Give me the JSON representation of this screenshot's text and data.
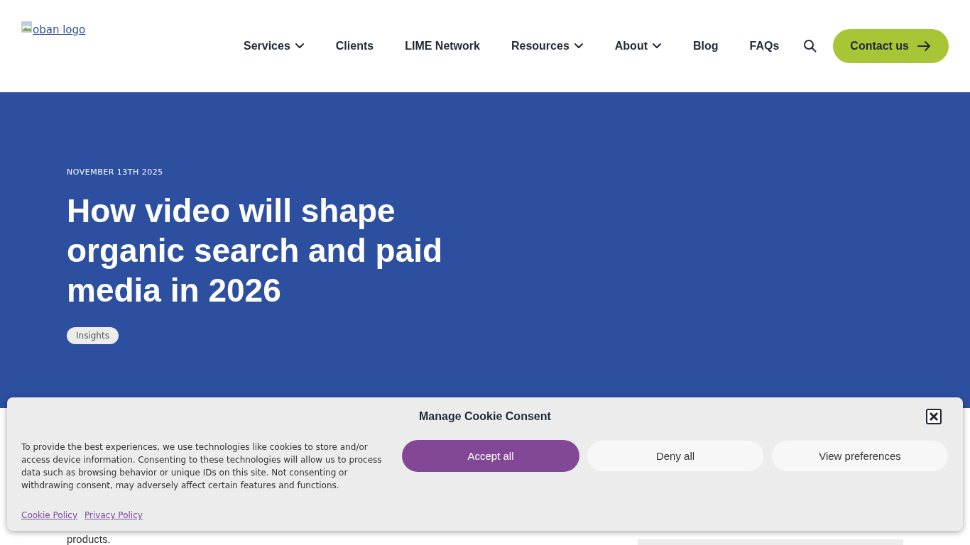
{
  "header": {
    "logo_alt": "oban logo",
    "nav": [
      {
        "label": "Services",
        "dropdown": true
      },
      {
        "label": "Clients",
        "dropdown": false
      },
      {
        "label": "LIME Network",
        "dropdown": false
      },
      {
        "label": "Resources",
        "dropdown": true
      },
      {
        "label": "About",
        "dropdown": true
      },
      {
        "label": "Blog",
        "dropdown": false
      },
      {
        "label": "FAQs",
        "dropdown": false
      }
    ],
    "cta": "Contact us"
  },
  "hero": {
    "date": "NOVEMBER 13TH 2025",
    "title": "How video will shape organic search and paid media in 2026",
    "tags": [
      "Insights"
    ]
  },
  "body": {
    "text": "products."
  },
  "cookie_banner": {
    "title": "Manage Cookie Consent",
    "message": "To provide the best experiences, we use technologies like cookies to store and/or access device information. Consenting to these technologies will allow us to process data such as browsing behavior or unique IDs on this site. Not consenting or withdrawing consent, may adversely affect certain features and functions.",
    "buttons": [
      {
        "label": "Accept all",
        "kind": "primary"
      },
      {
        "label": "Deny all",
        "kind": "secondary"
      },
      {
        "label": "View preferences",
        "kind": "secondary"
      }
    ],
    "links": [
      "Cookie Policy",
      "Privacy Policy"
    ]
  }
}
